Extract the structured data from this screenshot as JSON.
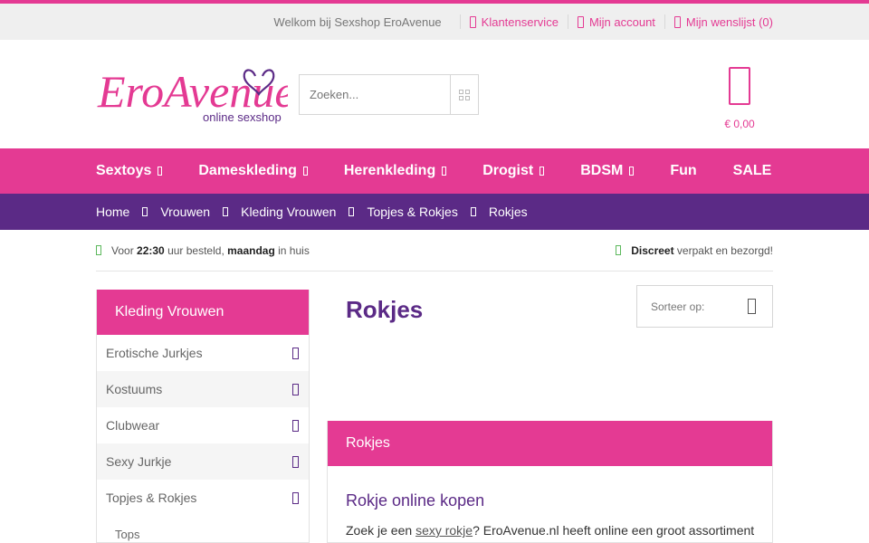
{
  "topbar": {
    "welcome": "Welkom bij Sexshop EroAvenue",
    "links": [
      {
        "label": "Klantenservice",
        "icon": "phone-icon"
      },
      {
        "label": "Mijn account",
        "icon": "user-icon"
      },
      {
        "label": "Mijn wenslijst (0)",
        "icon": "heart-icon"
      }
    ]
  },
  "logo": {
    "brand": "EroAvenue",
    "tagline": "online sexshop"
  },
  "search": {
    "placeholder": "Zoeken..."
  },
  "cart": {
    "total": "€ 0,00",
    "icon": "shopping-bag-icon"
  },
  "nav": {
    "items": [
      {
        "label": "Sextoys",
        "dropdown": true
      },
      {
        "label": "Dameskleding",
        "dropdown": true
      },
      {
        "label": "Herenkleding",
        "dropdown": true
      },
      {
        "label": "Drogist",
        "dropdown": true
      },
      {
        "label": "BDSM",
        "dropdown": true
      },
      {
        "label": "Fun",
        "dropdown": false
      },
      {
        "label": "SALE",
        "dropdown": false
      }
    ]
  },
  "breadcrumb": [
    "Home",
    "Vrouwen",
    "Kleding Vrouwen",
    "Topjes & Rokjes",
    "Rokjes"
  ],
  "usp": {
    "left": {
      "pre": "Voor ",
      "time": "22:30",
      "mid": " uur besteld, ",
      "day": "maandag",
      "post": " in huis"
    },
    "right": {
      "bold": "Discreet",
      "rest": " verpakt en bezorgd!"
    }
  },
  "sidebar": {
    "title": "Kleding Vrouwen",
    "items": [
      "Erotische Jurkjes",
      "Kostuums",
      "Clubwear",
      "Sexy Jurkje",
      "Topjes & Rokjes"
    ],
    "sub": "Tops"
  },
  "main": {
    "title": "Rokjes",
    "sort_label": "Sorteer op:",
    "panel_title": "Rokjes",
    "heading": "Rokje online kopen",
    "text_pre": "Zoek je een ",
    "text_link": "sexy rokje",
    "text_post": "? EroAvenue.nl heeft online een groot assortiment"
  },
  "colors": {
    "pink": "#e43a93",
    "purple": "#5b2a86",
    "green": "#5cb85c"
  }
}
